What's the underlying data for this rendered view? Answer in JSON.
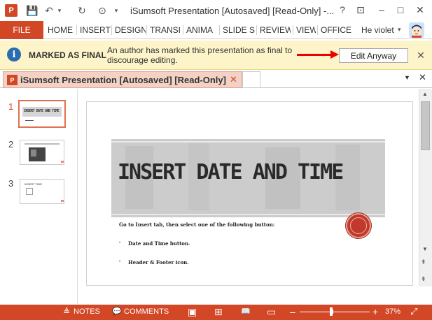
{
  "window": {
    "title": "iSumsoft Presentation [Autosaved] [Read-Only] -...",
    "app_icon_letter": "P",
    "qat": {
      "save": "💾",
      "undo": "↶",
      "undo_dropdown": "▾",
      "redo": "↻",
      "start": "⊙",
      "customize": "▾"
    },
    "controls": {
      "help": "?",
      "ribbon_options": "⊡",
      "minimize": "–",
      "maximize": "□",
      "close": "✕"
    }
  },
  "ribbon": {
    "file": "FILE",
    "tabs": [
      "HOME",
      "INSERT",
      "DESIGN",
      "TRANSI",
      "ANIMA",
      "SLIDE S",
      "REVIEW",
      "VIEW",
      "OFFICE"
    ],
    "user": "He violet",
    "user_caret": "▾"
  },
  "message_bar": {
    "icon": "i",
    "title": "MARKED AS FINAL",
    "text": "An author has marked this presentation as final to discourage editing.",
    "button": "Edit Anyway",
    "close": "✕"
  },
  "doc_tab": {
    "icon": "P",
    "title": "iSumsoft Presentation [Autosaved]  [Read-Only]",
    "close": "✕",
    "dropdown": "▼",
    "close_all": "✕"
  },
  "thumbnails": [
    {
      "number": "1",
      "label": "INSERT DATE AND TIME"
    },
    {
      "number": "2",
      "label": ""
    },
    {
      "number": "3",
      "label": "INSERT TIME"
    }
  ],
  "slide": {
    "title": "INSERT DATE AND TIME",
    "body": "Go to Insert tab, then select one of the following button:",
    "bullets": [
      "Date and Time button.",
      "Header & Footer icon."
    ],
    "bullet_glyph": "•"
  },
  "scrollbar": {
    "up": "▲",
    "down": "▼",
    "prev": "⇞",
    "next": "⇟"
  },
  "status": {
    "notes": "NOTES",
    "comments": "COMMENTS",
    "zoom_minus": "–",
    "zoom_plus": "+",
    "zoom": "37%",
    "zoom_level": 0.37,
    "notes_icon": "≜",
    "comments_icon": "💬",
    "view_normal": "▣",
    "view_sorter": "⊞",
    "view_reading": "📖",
    "view_show": "▭",
    "fit": "⤢"
  },
  "colors": {
    "accent": "#d24726",
    "message_bar": "#fdf5c9",
    "arrow": "#e00000"
  }
}
